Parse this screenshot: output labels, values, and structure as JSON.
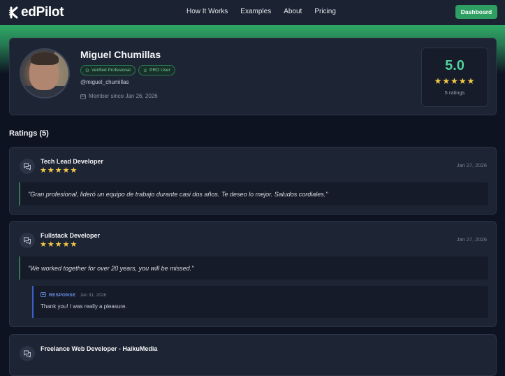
{
  "nav": {
    "logo_text": "edPilot",
    "links": [
      "How It Works",
      "Examples",
      "About",
      "Pricing"
    ],
    "dashboard_label": "Dashboard",
    "accent": "#2f9e62"
  },
  "profile": {
    "name": "Miguel Chumillas",
    "badges": [
      "Verified Profesional",
      "PRO User"
    ],
    "handle": "@miguel_chumillas",
    "member_since": "Member since Jan 26, 2026",
    "score": "5.0",
    "stars": "★★★★★",
    "rating_count": "5 ratings"
  },
  "ratings_title": "Ratings (5)",
  "reviews": [
    {
      "title": "Tech Lead Developer",
      "stars": "★★★★★",
      "date": "Jan 27, 2026",
      "quote": "\"Gran profesional, lideró un equipo de trabajo durante casi dos años. Te deseo lo mejor. Saludos cordiales.\""
    },
    {
      "title": "Fullstack Developer",
      "stars": "★★★★★",
      "date": "Jan 27, 2026",
      "quote": "\"We worked together for over 20 years, you will be missed.\"",
      "response": {
        "label": "RESPONSE",
        "date": "Jan 31, 2026",
        "text": "Thank you! I was really a pleasure."
      }
    },
    {
      "title": "Freelance Web Developer - HaikuMedia"
    }
  ]
}
